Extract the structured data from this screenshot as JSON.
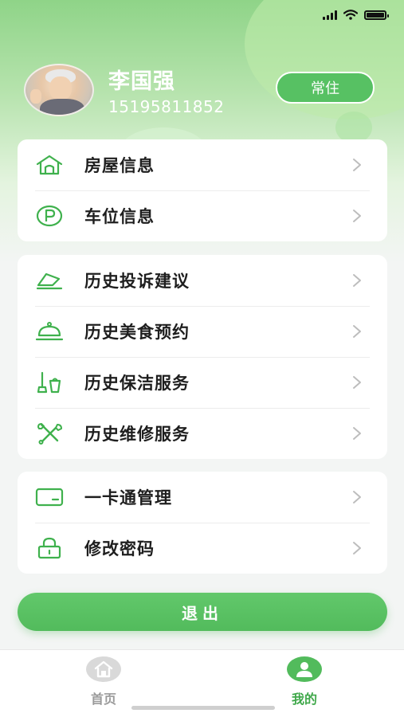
{
  "colors": {
    "accent": "#52bb5c",
    "icon_green": "#3fb14d",
    "tab_inactive": "#9a9a9a"
  },
  "user": {
    "name": "李国强",
    "phone": "15195811852",
    "badge": "常住"
  },
  "menu_groups": [
    {
      "items": [
        {
          "label": "房屋信息",
          "icon": "house-icon"
        },
        {
          "label": "车位信息",
          "icon": "parking-icon"
        }
      ]
    },
    {
      "items": [
        {
          "label": "历史投诉建议",
          "icon": "feedback-icon"
        },
        {
          "label": "历史美食预约",
          "icon": "food-cloche-icon"
        },
        {
          "label": "历史保洁服务",
          "icon": "cleaning-icon"
        },
        {
          "label": "历史维修服务",
          "icon": "repair-tools-icon"
        }
      ]
    },
    {
      "items": [
        {
          "label": "一卡通管理",
          "icon": "card-icon"
        },
        {
          "label": "修改密码",
          "icon": "lock-icon"
        }
      ]
    }
  ],
  "logout_label": "退出",
  "tabs": [
    {
      "label": "首页",
      "icon": "home-tab-icon",
      "active": false
    },
    {
      "label": "我的",
      "icon": "profile-tab-icon",
      "active": true
    }
  ]
}
